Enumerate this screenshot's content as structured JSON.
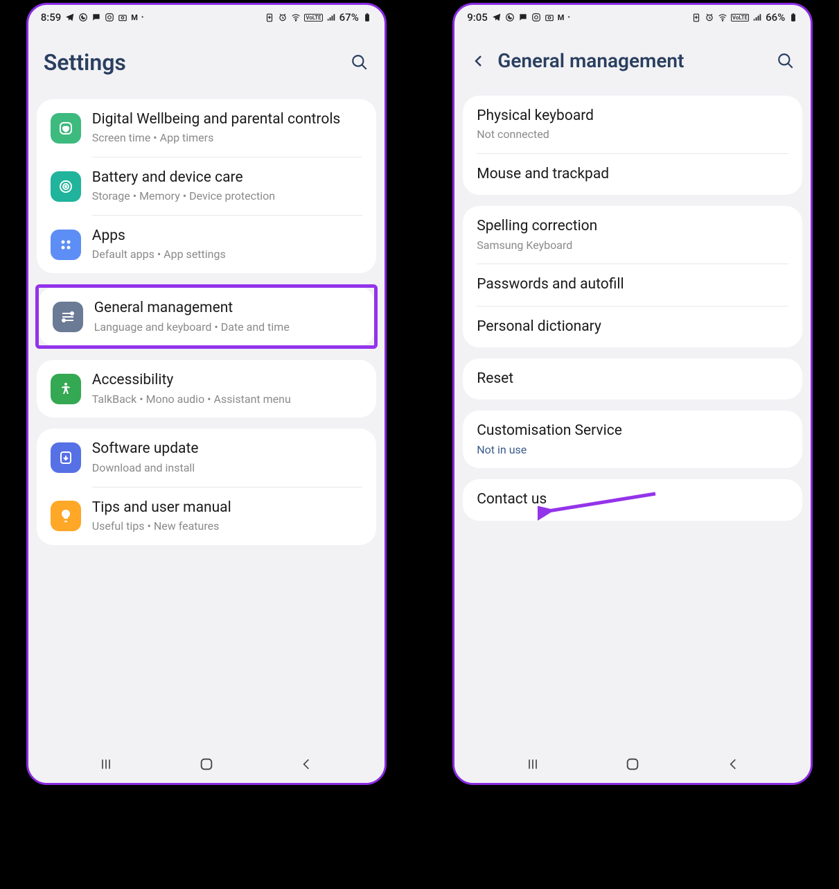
{
  "left": {
    "status": {
      "time": "8:59",
      "battery": "67%"
    },
    "header": {
      "title": "Settings"
    },
    "groups": [
      {
        "rows": [
          {
            "icon": "wellbeing-icon",
            "color": "ic-green",
            "title": "Digital Wellbeing and parental controls",
            "sub": "Screen time  •  App timers"
          },
          {
            "icon": "device-care-icon",
            "color": "ic-teal",
            "title": "Battery and device care",
            "sub": "Storage  •  Memory  •  Device protection"
          },
          {
            "icon": "apps-icon",
            "color": "ic-blue",
            "title": "Apps",
            "sub": "Default apps  •  App settings"
          }
        ]
      },
      {
        "highlight": true,
        "rows": [
          {
            "icon": "general-icon",
            "color": "ic-gray",
            "title": "General management",
            "sub": "Language and keyboard  •  Date and time"
          }
        ]
      },
      {
        "rows": [
          {
            "icon": "accessibility-icon",
            "color": "ic-green2",
            "title": "Accessibility",
            "sub": "TalkBack  •  Mono audio  •  Assistant menu"
          }
        ]
      },
      {
        "rows": [
          {
            "icon": "update-icon",
            "color": "ic-blue2",
            "title": "Software update",
            "sub": "Download and install"
          },
          {
            "icon": "tips-icon",
            "color": "ic-orange",
            "title": "Tips and user manual",
            "sub": "Useful tips  •  New features"
          }
        ]
      }
    ]
  },
  "right": {
    "status": {
      "time": "9:05",
      "battery": "66%"
    },
    "header": {
      "title": "General management"
    },
    "groups": [
      {
        "rows": [
          {
            "title": "Physical keyboard",
            "sub": "Not connected"
          },
          {
            "title": "Mouse and trackpad"
          }
        ]
      },
      {
        "rows": [
          {
            "title": "Spelling correction",
            "sub": "Samsung Keyboard"
          },
          {
            "title": "Passwords and autofill"
          },
          {
            "title": "Personal dictionary"
          }
        ]
      },
      {
        "rows": [
          {
            "title": "Reset"
          }
        ]
      },
      {
        "rows": [
          {
            "title": "Customisation Service",
            "sub": "Not in use",
            "sublink": true
          }
        ]
      },
      {
        "rows": [
          {
            "title": "Contact us"
          }
        ]
      }
    ]
  }
}
